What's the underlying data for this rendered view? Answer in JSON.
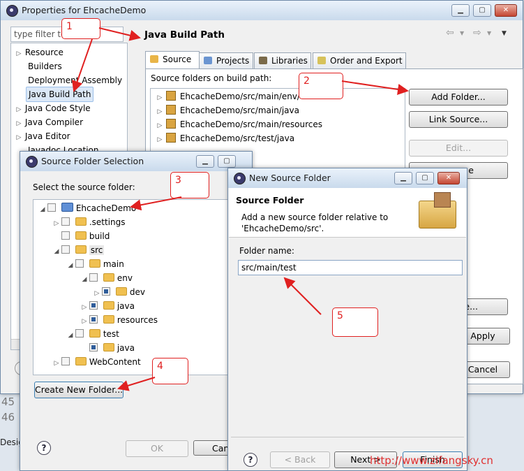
{
  "properties_window": {
    "title": "Properties for EhcacheDemo",
    "filter_placeholder": "type filter text",
    "filter_value": "type filter te",
    "tree": [
      "Resource",
      "Builders",
      "Deployment Assembly",
      "Java Build Path",
      "Java Code Style",
      "Java Compiler",
      "Java Editor",
      "Javadoc Location"
    ],
    "selected_item": "Java Build Path",
    "page_title": "Java Build Path",
    "tabs": [
      "Source",
      "Projects",
      "Libraries",
      "Order and Export"
    ],
    "source_folders_label": "Source folders on build path:",
    "source_folders": [
      "EhcacheDemo/src/main/env/",
      "EhcacheDemo/src/main/java",
      "EhcacheDemo/src/main/resources",
      "EhcacheDemo/src/test/java"
    ],
    "buttons": {
      "add_folder": "Add Folder...",
      "link_source": "Link Source...",
      "edit": "Edit...",
      "remove_partial": "e",
      "other_partial": "e...",
      "apply": "Apply",
      "cancel": "Cancel"
    }
  },
  "source_folder_dialog": {
    "title": "Source Folder Selection",
    "instruction": "Select the source folder:",
    "tree": [
      {
        "label": "EhcacheDemo",
        "indent": 0
      },
      {
        "label": ".settings",
        "indent": 1
      },
      {
        "label": "build",
        "indent": 1
      },
      {
        "label": "src",
        "indent": 1
      },
      {
        "label": "main",
        "indent": 2
      },
      {
        "label": "env",
        "indent": 3
      },
      {
        "label": "dev",
        "indent": 4
      },
      {
        "label": "java",
        "indent": 3
      },
      {
        "label": "resources",
        "indent": 3
      },
      {
        "label": "test",
        "indent": 2
      },
      {
        "label": "java",
        "indent": 3
      },
      {
        "label": "WebContent",
        "indent": 1
      }
    ],
    "create_folder_button": "Create New Folder...",
    "ok_button": "OK",
    "cancel_button": "Can"
  },
  "new_source_folder_dialog": {
    "title": "New Source Folder",
    "heading": "Source Folder",
    "description_line1": "Add a new source folder relative to",
    "description_line2": "'EhcacheDemo/src'.",
    "folder_name_label": "Folder name:",
    "folder_name_value": "src/main/test",
    "back_button": "< Back",
    "next_button": "Next >",
    "finish_button": "Finish"
  },
  "background": {
    "line_45": "45",
    "line_46": "46",
    "design_tab": "Design"
  },
  "annotations": [
    "1",
    "2",
    "3",
    "4",
    "5"
  ],
  "watermark": "http://www.zifangsky.cn",
  "colors": {
    "annotation": "#e02020",
    "window_border": "#6f8aa8",
    "selection": "#dbe8f7"
  }
}
